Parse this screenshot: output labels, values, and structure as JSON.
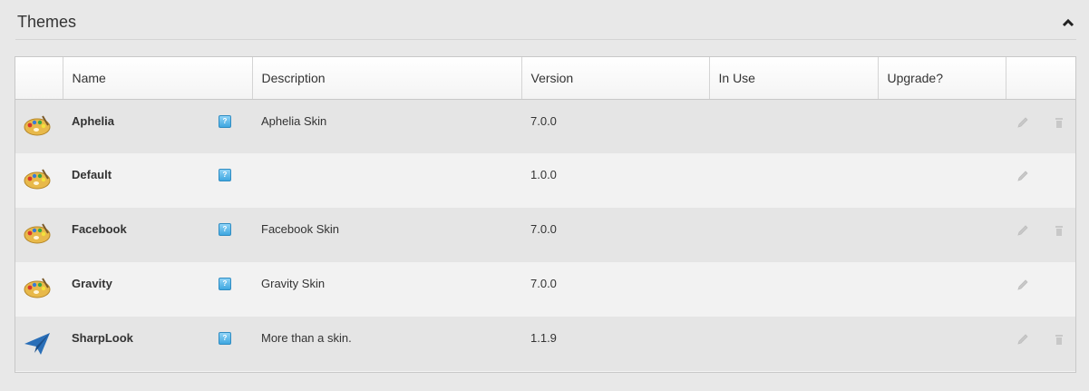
{
  "panel": {
    "title": "Themes"
  },
  "table": {
    "headers": [
      "",
      "Name",
      "Description",
      "Version",
      "In Use",
      "Upgrade?",
      ""
    ],
    "rows": [
      {
        "icon": "palette-icon",
        "name": "Aphelia",
        "description": "Aphelia Skin",
        "version": "7.0.0",
        "in_use": "",
        "upgrade": "",
        "deletable": true
      },
      {
        "icon": "palette-icon",
        "name": "Default",
        "description": "",
        "version": "1.0.0",
        "in_use": "",
        "upgrade": "",
        "deletable": false
      },
      {
        "icon": "palette-icon",
        "name": "Facebook",
        "description": "Facebook Skin",
        "version": "7.0.0",
        "in_use": "",
        "upgrade": "",
        "deletable": true
      },
      {
        "icon": "palette-icon",
        "name": "Gravity",
        "description": "Gravity Skin",
        "version": "7.0.0",
        "in_use": "",
        "upgrade": "",
        "deletable": false
      },
      {
        "icon": "paper-plane-icon",
        "name": "SharpLook",
        "description": "More than a skin.",
        "version": "1.1.9",
        "in_use": "",
        "upgrade": "",
        "deletable": true
      }
    ]
  },
  "help_icon_glyph": "?",
  "colors": {
    "help_blue": "#3fa7e0",
    "row_odd": "#e5e5e5",
    "row_even": "#f2f2f2"
  }
}
